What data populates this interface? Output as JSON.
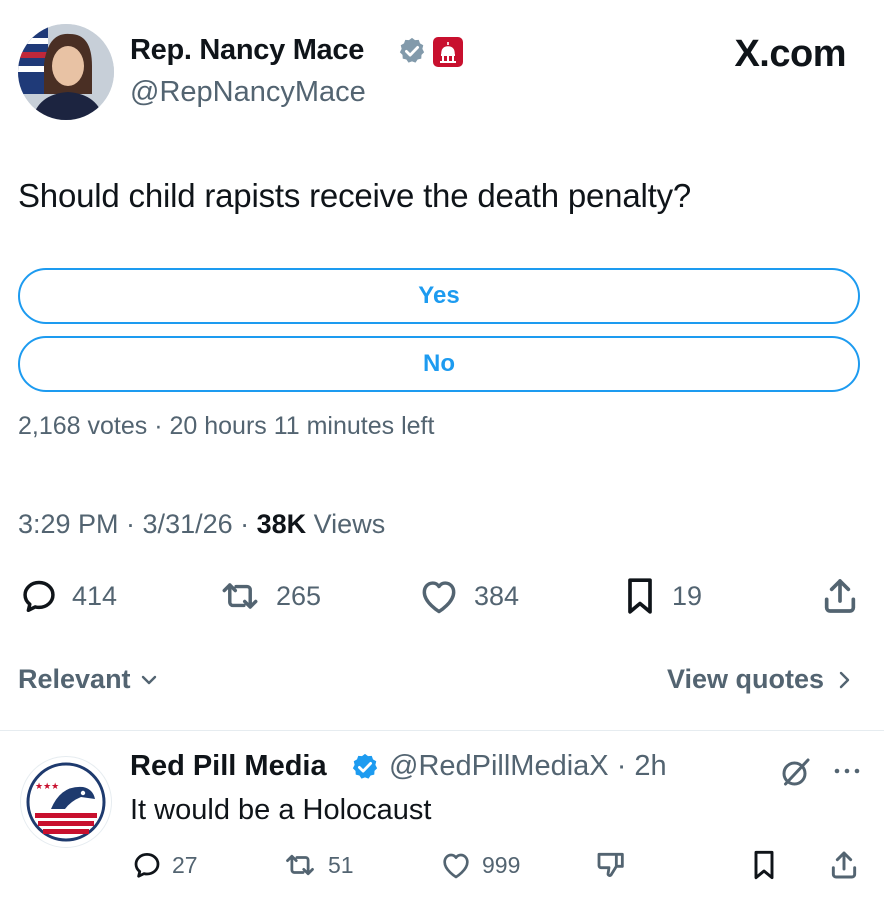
{
  "tweet": {
    "author_name": "Rep. Nancy Mace",
    "author_handle": "@RepNancyMace",
    "brand": "X.com",
    "text": "Should child rapists receive the death penalty?",
    "poll": {
      "options": [
        "Yes",
        "No"
      ],
      "meta": "2,168 votes · 20 hours 11 minutes left"
    },
    "timestamp": "3:29 PM · 3/31/26 · ",
    "views_count": "38K",
    "views_label": " Views",
    "actions": {
      "replies": "414",
      "reposts": "265",
      "likes": "384",
      "bookmarks": "19"
    }
  },
  "conversation": {
    "filter_label": "Relevant",
    "quotes_label": "View quotes"
  },
  "reply": {
    "author_name": "Red Pill Media",
    "author_handle": "@RedPillMediaX · 2h",
    "text": "It would be a Holocaust",
    "actions": {
      "replies": "27",
      "reposts": "51",
      "likes": "999"
    }
  },
  "colors": {
    "accent": "#1d9bf0",
    "text": "#0f1419",
    "secondary": "#536471",
    "verified_grey": "#829aab",
    "gov_badge": "#c8102e"
  }
}
